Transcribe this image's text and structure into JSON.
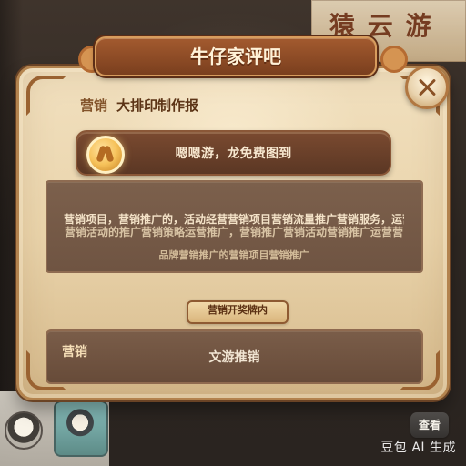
{
  "background": {
    "top_right_text": "猿 云 游"
  },
  "dialog": {
    "title": "牛仔家评吧",
    "subtitle_label": "营销",
    "subtitle_value": "大排印制作报",
    "mission_text": "嗯嗯游，龙免费图到",
    "info_line_1": "营销项目，营销推广的，活动经营营销项目营销流量推广营销服务，运营推",
    "info_line_2": "营销活动的推广营销策略运营推广，营销推广营销活动营销推广运营营",
    "info_line_3": "品牌营销推广的营销项目营销推广",
    "small_banner": "营销开奖牌内",
    "bottom_left": "营销",
    "bottom_center": "文游推销"
  },
  "bottom": {
    "tag": "查看",
    "watermark": "豆包 AI 生成"
  },
  "icons": {
    "close": "close-icon",
    "mission": "seed-icon",
    "avatar": "avatar-icon"
  }
}
